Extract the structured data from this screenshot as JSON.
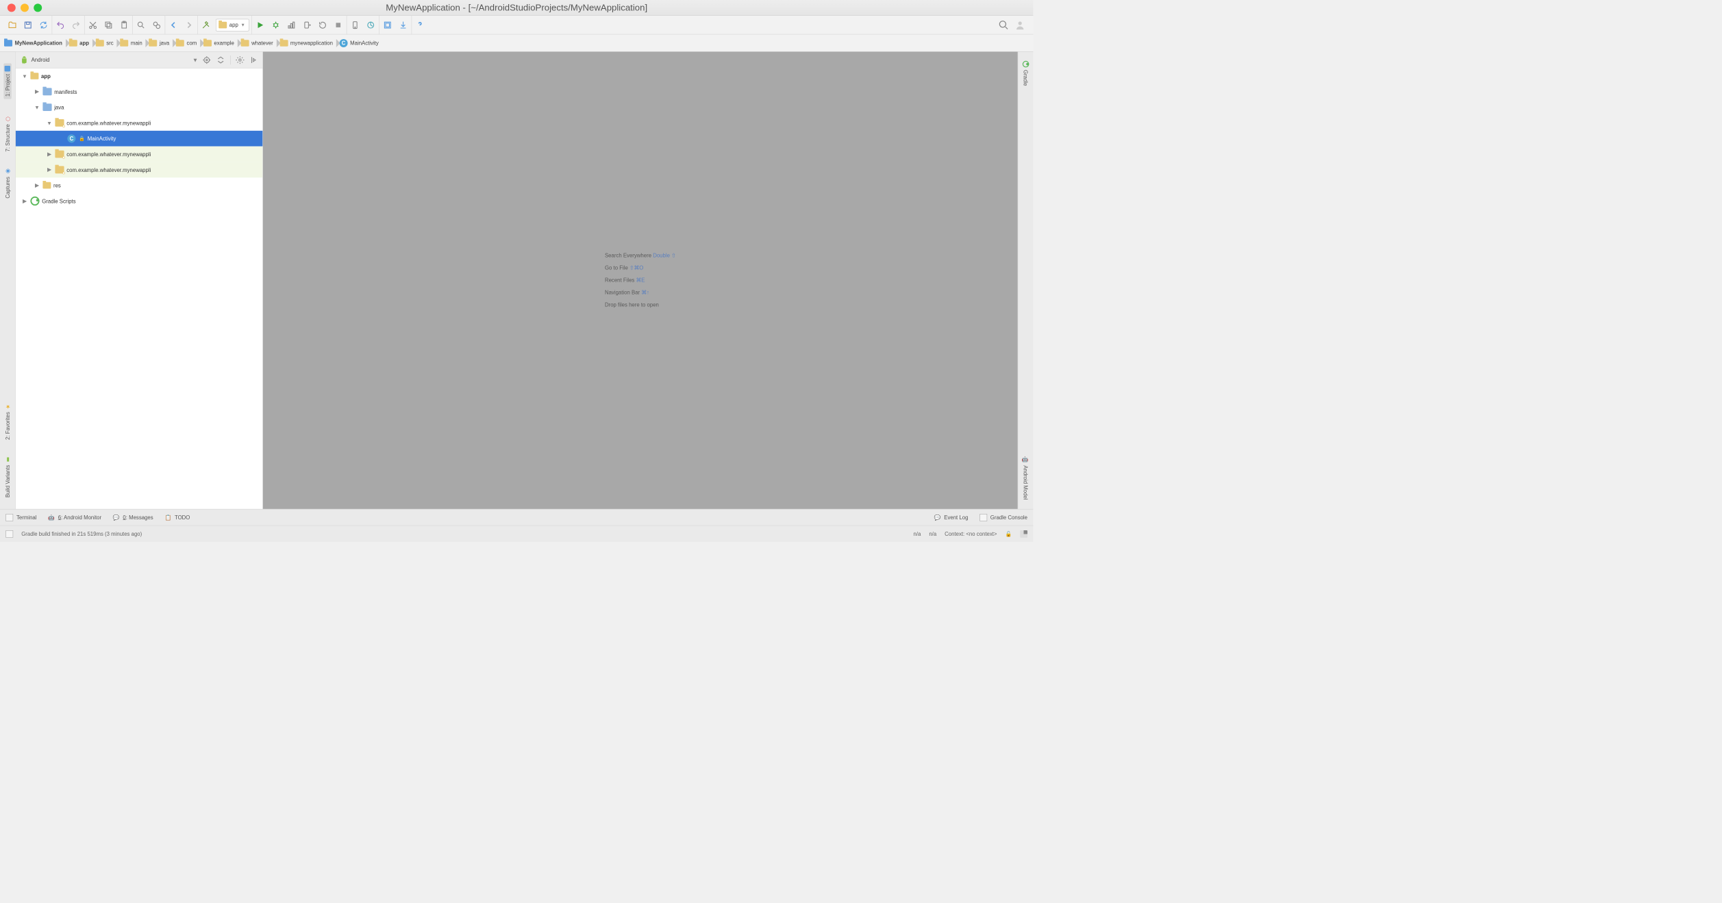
{
  "title": "MyNewApplication - [~/AndroidStudioProjects/MyNewApplication]",
  "module_selector": "app",
  "breadcrumbs": [
    {
      "icon": "proj",
      "label": "MyNewApplication"
    },
    {
      "icon": "folder",
      "label": "app"
    },
    {
      "icon": "folder",
      "label": "src"
    },
    {
      "icon": "folder",
      "label": "main"
    },
    {
      "icon": "folder",
      "label": "java"
    },
    {
      "icon": "folder",
      "label": "com"
    },
    {
      "icon": "folder",
      "label": "example"
    },
    {
      "icon": "folder",
      "label": "whatever"
    },
    {
      "icon": "folder",
      "label": "mynewapplication"
    },
    {
      "icon": "class",
      "label": "MainActivity"
    }
  ],
  "left_tabs": [
    "1: Project",
    "7: Structure",
    "Captures",
    "2: Favorites",
    "Build Variants"
  ],
  "right_tabs": [
    "Gradle",
    "Android Model"
  ],
  "project_panel": {
    "view": "Android",
    "tree": {
      "app": "app",
      "manifests": "manifests",
      "java": "java",
      "pkg1": "com.example.whatever.mynewappli",
      "main_activity": "MainActivity",
      "pkg2": "com.example.whatever.mynewappli",
      "pkg3": "com.example.whatever.mynewappli",
      "res": "res",
      "gradle_scripts": "Gradle Scripts"
    }
  },
  "editor_hints": {
    "search_label": "Search Everywhere ",
    "search_shortcut": "Double ⇧",
    "goto_label": "Go to File ",
    "goto_shortcut": "⇧⌘O",
    "recent_label": "Recent Files ",
    "recent_shortcut": "⌘E",
    "navbar_label": "Navigation Bar ",
    "navbar_shortcut": "⌘↑",
    "drop_label": "Drop files here to open"
  },
  "bottom_buttons": {
    "terminal": "Terminal",
    "android_monitor": "6: Android Monitor",
    "messages": "0: Messages",
    "todo": "TODO",
    "event_log": "Event Log",
    "gradle_console": "Gradle Console"
  },
  "status": {
    "message": "Gradle build finished in 21s 519ms (3 minutes ago)",
    "na1": "n/a",
    "na2": "n/a",
    "context": "Context: <no context>"
  }
}
